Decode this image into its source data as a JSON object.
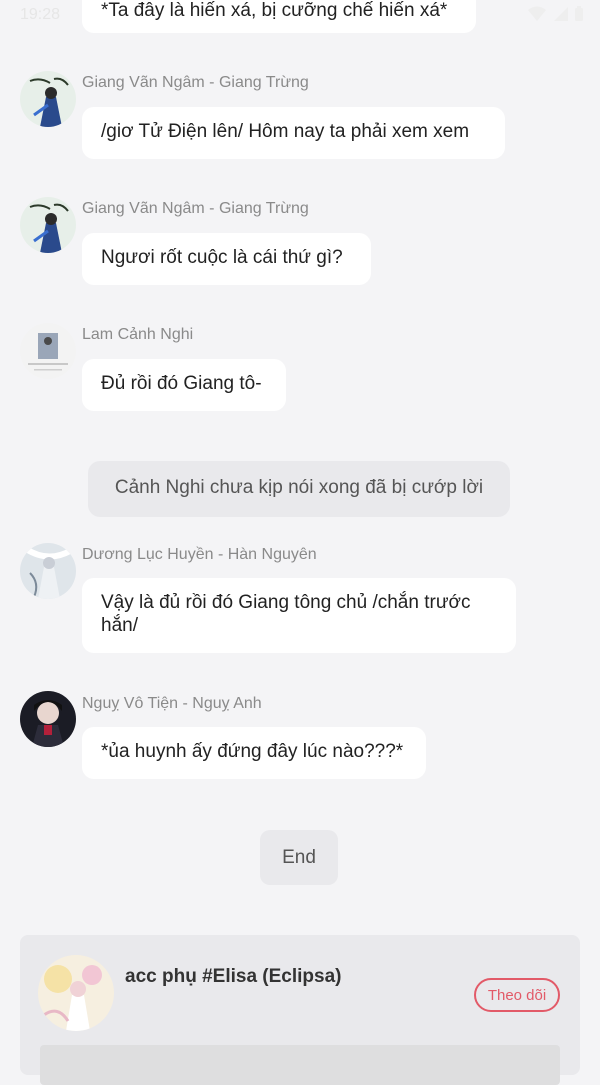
{
  "status_bar": {
    "time": "19:28"
  },
  "messages": [
    {
      "speaker": "",
      "text": "*Ta đây là hiến xá, bị cưỡng chế hiến xá*"
    },
    {
      "speaker": "Giang Vãn Ngâm - Giang Trừng",
      "text": "/giơ Tử Điện lên/ Hôm nay ta phải xem xem"
    },
    {
      "speaker": "Giang Vãn Ngâm - Giang Trừng",
      "text": "Ngươi rốt cuộc là cái thứ gì?"
    },
    {
      "speaker": "Lam Cảnh Nghi",
      "text": "Đủ rồi đó Giang tô-"
    },
    {
      "narration": "Cảnh Nghi chưa kịp nói xong đã bị cướp lời"
    },
    {
      "speaker": "Dương Lục Huyền - Hàn Nguyên",
      "text_line1": "Vậy là đủ rồi đó Giang tông chủ /chắn trước",
      "text_line2": "hắn/"
    },
    {
      "speaker": "Nguỵ Vô Tiện - Nguỵ Anh",
      "text": "*ủa huynh ấy đứng đây lúc nào???*"
    }
  ],
  "end_label": "End",
  "author": {
    "name": "acc phụ #Elisa (Eclipsa)",
    "follow_label": "Theo dõi"
  },
  "colors": {
    "accent": "#e25a68",
    "background": "#f4f4f6",
    "bubble": "#ffffff"
  }
}
